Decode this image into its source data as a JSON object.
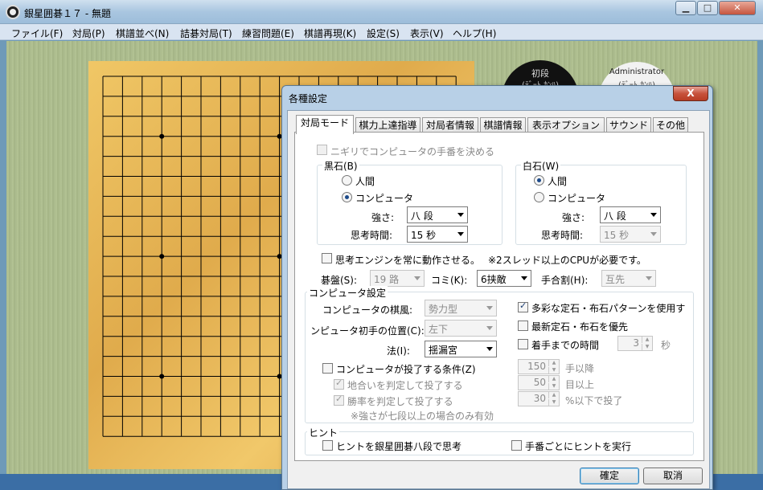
{
  "window": {
    "title": "銀星囲碁１７ - 無題",
    "min_label": "▁",
    "max_label": "□",
    "close_label": "✕"
  },
  "menu": [
    {
      "label": "ファイル(F)"
    },
    {
      "label": "対局(P)"
    },
    {
      "label": "棋譜並べ(N)"
    },
    {
      "label": "詰碁対局(T)"
    },
    {
      "label": "練習問題(E)"
    },
    {
      "label": "棋譜再現(K)"
    },
    {
      "label": "設定(S)"
    },
    {
      "label": "表示(V)"
    },
    {
      "label": "ヘルプ(H)"
    }
  ],
  "players": {
    "black": {
      "rank": "初段",
      "sub": "(ﾃﾞｰﾄ ｶﾝﾊ)"
    },
    "white": {
      "name": "Administrator",
      "sub": "(ﾃﾞｰﾄ ｶﾝﾊ)"
    }
  },
  "dialog": {
    "title": "各種設定",
    "close_label": "X",
    "tabs": [
      "対局モード",
      "棋力上達指導",
      "対局者情報",
      "棋譜情報",
      "表示オプション",
      "サウンド",
      "その他"
    ],
    "nigiri": "ニギリでコンピュータの手番を決める",
    "black": {
      "group": "黒石(B)",
      "human": "人間",
      "computer": "コンピュータ",
      "strength_label": "強さ:",
      "strength": "八 段",
      "time_label": "思考時間:",
      "time": "15 秒"
    },
    "white": {
      "group": "白石(W)",
      "human": "人間",
      "computer": "コンピュータ",
      "strength_label": "強さ:",
      "strength": "八 段",
      "time_label": "思考時間:",
      "time": "15 秒"
    },
    "engine_always": "思考エンジンを常に動作させる。",
    "engine_note": "※2スレッド以上のCPUが必要です。",
    "board_label": "碁盤(S):",
    "board": "19 路",
    "komi_label": "コミ(K):",
    "komi": "6挟敵",
    "handicap_label": "手合割(H):",
    "handicap": "互先",
    "comp_group": "コンピュータ設定",
    "style_label": "コンピュータの棋風:",
    "style": "勢力型",
    "first_label": "ンピュータ初手の位置(C):",
    "first": "左下",
    "method_label": "法(I):",
    "method": "揺漏宮",
    "varied": "多彩な定石・布石パターンを使用す",
    "newest": "最新定石・布石を優先",
    "time_until": "着手までの時間",
    "time_until_val": "3",
    "time_until_unit": "秒",
    "resign": "コンピュータが投了する条件(Z)",
    "resign_territory": "地合いを判定して投了する",
    "resign_winrate": "勝率を判定して投了する",
    "resign_note": "※強さが七段以上の場合のみ有効",
    "move_after": "150",
    "move_after_unit": "手以降",
    "territory_over": "50",
    "territory_unit": "目以上",
    "winrate_below": "30",
    "winrate_unit": "%以下で投了",
    "hint_group": "ヒント",
    "hint_ginsei": "ヒントを銀星囲碁八段で思考",
    "hint_every": "手番ごとにヒントを実行",
    "ok": "確定",
    "cancel": "取消"
  }
}
